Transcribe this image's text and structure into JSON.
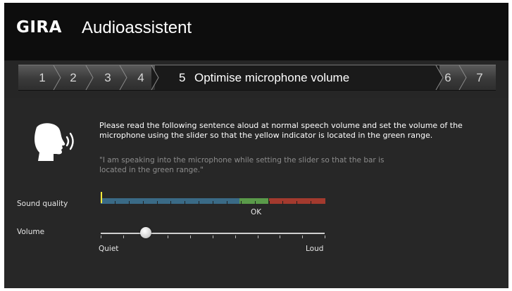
{
  "header": {
    "brand": "GIRA",
    "title": "Audioassistent"
  },
  "steps": {
    "items": [
      "1",
      "2",
      "3",
      "4",
      "6",
      "7"
    ],
    "active": {
      "number": "5",
      "label": "Optimise microphone volume"
    }
  },
  "content": {
    "icon": "speaking-head-icon",
    "instruction": "Please read the following sentence aloud at normal speech volume and set the volume of the microphone using the slider so that the yellow indicator is located in the green range.",
    "quote": "\"I am speaking into the microphone while setting the slider so that the bar is located in the green range.\""
  },
  "sound_quality": {
    "label": "Sound quality",
    "level": 0.0,
    "ok_label": "OK",
    "ranges": [
      {
        "name": "low",
        "color": "#3a6a86",
        "from": 0.0,
        "to": 0.62
      },
      {
        "name": "ok",
        "color": "#5a9a4a",
        "from": 0.62,
        "to": 0.75
      },
      {
        "name": "high",
        "color": "#a33a2e",
        "from": 0.75,
        "to": 1.0
      }
    ],
    "indicator_color": "#ffeb3b"
  },
  "volume": {
    "label": "Volume",
    "value": 0.2,
    "min_label": "Quiet",
    "max_label": "Loud"
  },
  "colors": {
    "header_bg": "#0d0d0d",
    "body_bg": "#272727",
    "text": "#ffffff",
    "muted_text": "#8c8c8c"
  }
}
